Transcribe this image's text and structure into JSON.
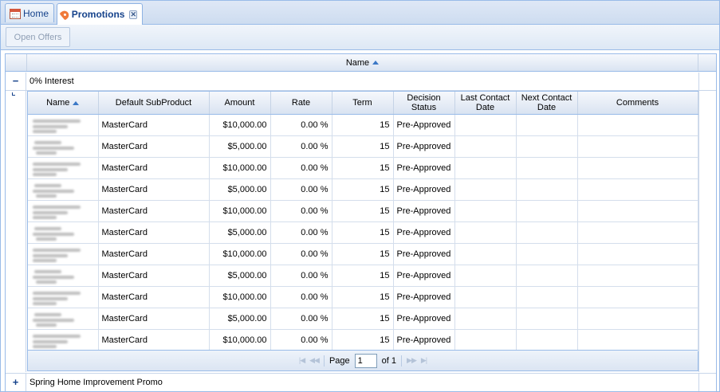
{
  "tabs": [
    {
      "label": "Home",
      "icon": "calendar-home-icon",
      "active": false
    },
    {
      "label": "Promotions",
      "icon": "tag-icon",
      "active": true,
      "close": "✕"
    }
  ],
  "toolbar": {
    "open_offers_label": "Open Offers",
    "open_offers_enabled": false
  },
  "outer_grid": {
    "header": {
      "name": "Name"
    },
    "groups": [
      {
        "label": "0% Interest",
        "expander": "−",
        "expanded": true
      },
      {
        "label": "Spring Home Improvement Promo",
        "expander": "+",
        "expanded": false
      }
    ]
  },
  "inner_grid": {
    "columns": [
      "Name",
      "Default SubProduct",
      "Amount",
      "Rate",
      "Term",
      "Decision Status",
      "Last Contact Date",
      "Next Contact Date",
      "Comments"
    ],
    "rows": [
      {
        "name": "",
        "subproduct": "MasterCard",
        "amount": "$10,000.00",
        "rate": "0.00 %",
        "term": "15",
        "status": "Pre-Approved",
        "last": "",
        "next": "",
        "comments": ""
      },
      {
        "name": "",
        "subproduct": "MasterCard",
        "amount": "$5,000.00",
        "rate": "0.00 %",
        "term": "15",
        "status": "Pre-Approved",
        "last": "",
        "next": "",
        "comments": ""
      },
      {
        "name": "",
        "subproduct": "MasterCard",
        "amount": "$10,000.00",
        "rate": "0.00 %",
        "term": "15",
        "status": "Pre-Approved",
        "last": "",
        "next": "",
        "comments": ""
      },
      {
        "name": "",
        "subproduct": "MasterCard",
        "amount": "$5,000.00",
        "rate": "0.00 %",
        "term": "15",
        "status": "Pre-Approved",
        "last": "",
        "next": "",
        "comments": ""
      },
      {
        "name": "",
        "subproduct": "MasterCard",
        "amount": "$10,000.00",
        "rate": "0.00 %",
        "term": "15",
        "status": "Pre-Approved",
        "last": "",
        "next": "",
        "comments": ""
      },
      {
        "name": "",
        "subproduct": "MasterCard",
        "amount": "$5,000.00",
        "rate": "0.00 %",
        "term": "15",
        "status": "Pre-Approved",
        "last": "",
        "next": "",
        "comments": ""
      },
      {
        "name": "",
        "subproduct": "MasterCard",
        "amount": "$10,000.00",
        "rate": "0.00 %",
        "term": "15",
        "status": "Pre-Approved",
        "last": "",
        "next": "",
        "comments": ""
      },
      {
        "name": "",
        "subproduct": "MasterCard",
        "amount": "$5,000.00",
        "rate": "0.00 %",
        "term": "15",
        "status": "Pre-Approved",
        "last": "",
        "next": "",
        "comments": ""
      },
      {
        "name": "",
        "subproduct": "MasterCard",
        "amount": "$10,000.00",
        "rate": "0.00 %",
        "term": "15",
        "status": "Pre-Approved",
        "last": "",
        "next": "",
        "comments": ""
      },
      {
        "name": "",
        "subproduct": "MasterCard",
        "amount": "$5,000.00",
        "rate": "0.00 %",
        "term": "15",
        "status": "Pre-Approved",
        "last": "",
        "next": "",
        "comments": ""
      },
      {
        "name": "",
        "subproduct": "MasterCard",
        "amount": "$10,000.00",
        "rate": "0.00 %",
        "term": "15",
        "status": "Pre-Approved",
        "last": "",
        "next": "",
        "comments": ""
      }
    ],
    "sort_column": "Name",
    "sort_direction": "ascending",
    "pager": {
      "page_label": "Page",
      "page_value": "1",
      "of_label": "of 1",
      "first": "|◀",
      "prev": "◀◀",
      "next": "▶▶",
      "last": "▶|"
    }
  },
  "colors": {
    "border": "#99bbe8",
    "tab_text": "#15428b",
    "sort_arrow": "#3b78c6"
  }
}
